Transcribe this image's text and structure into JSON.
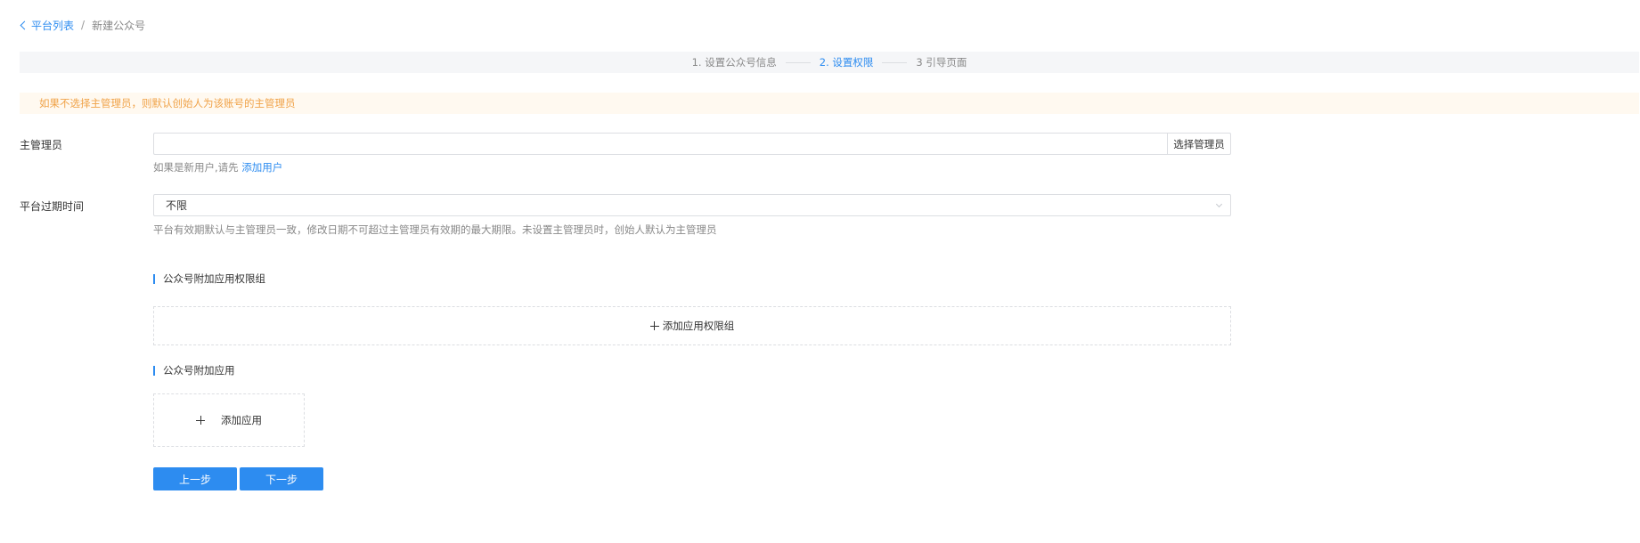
{
  "breadcrumb": {
    "back_label": "平台列表",
    "separator": "/",
    "current": "新建公众号"
  },
  "steps": [
    {
      "label": "1. 设置公众号信息",
      "active": false
    },
    {
      "label": "2. 设置权限",
      "active": true
    },
    {
      "label": "3 引导页面",
      "active": false
    }
  ],
  "alert": {
    "text": "如果不选择主管理员，则默认创始人为该账号的主管理员"
  },
  "form": {
    "admin": {
      "label": "主管理员",
      "value": "",
      "button_label": "选择管理员",
      "help_prefix": "如果是新用户,请先",
      "help_link": "添加用户"
    },
    "expiry": {
      "label": "平台过期时间",
      "selected": "不限",
      "help": "平台有效期默认与主管理员一致，修改日期不可超过主管理员有效期的最大期限。未设置主管理员时，创始人默认为主管理员"
    }
  },
  "sections": {
    "permission_group": {
      "title": "公众号附加应用权限组",
      "add_label": "添加应用权限组"
    },
    "apps": {
      "title": "公众号附加应用",
      "add_label": "添加应用"
    }
  },
  "actions": {
    "prev_label": "上一步",
    "next_label": "下一步"
  },
  "colors": {
    "primary": "#2d8cf0",
    "warning_text": "#f0a247",
    "warning_bg": "#fff9f0",
    "steps_bg": "#f5f6f8"
  }
}
